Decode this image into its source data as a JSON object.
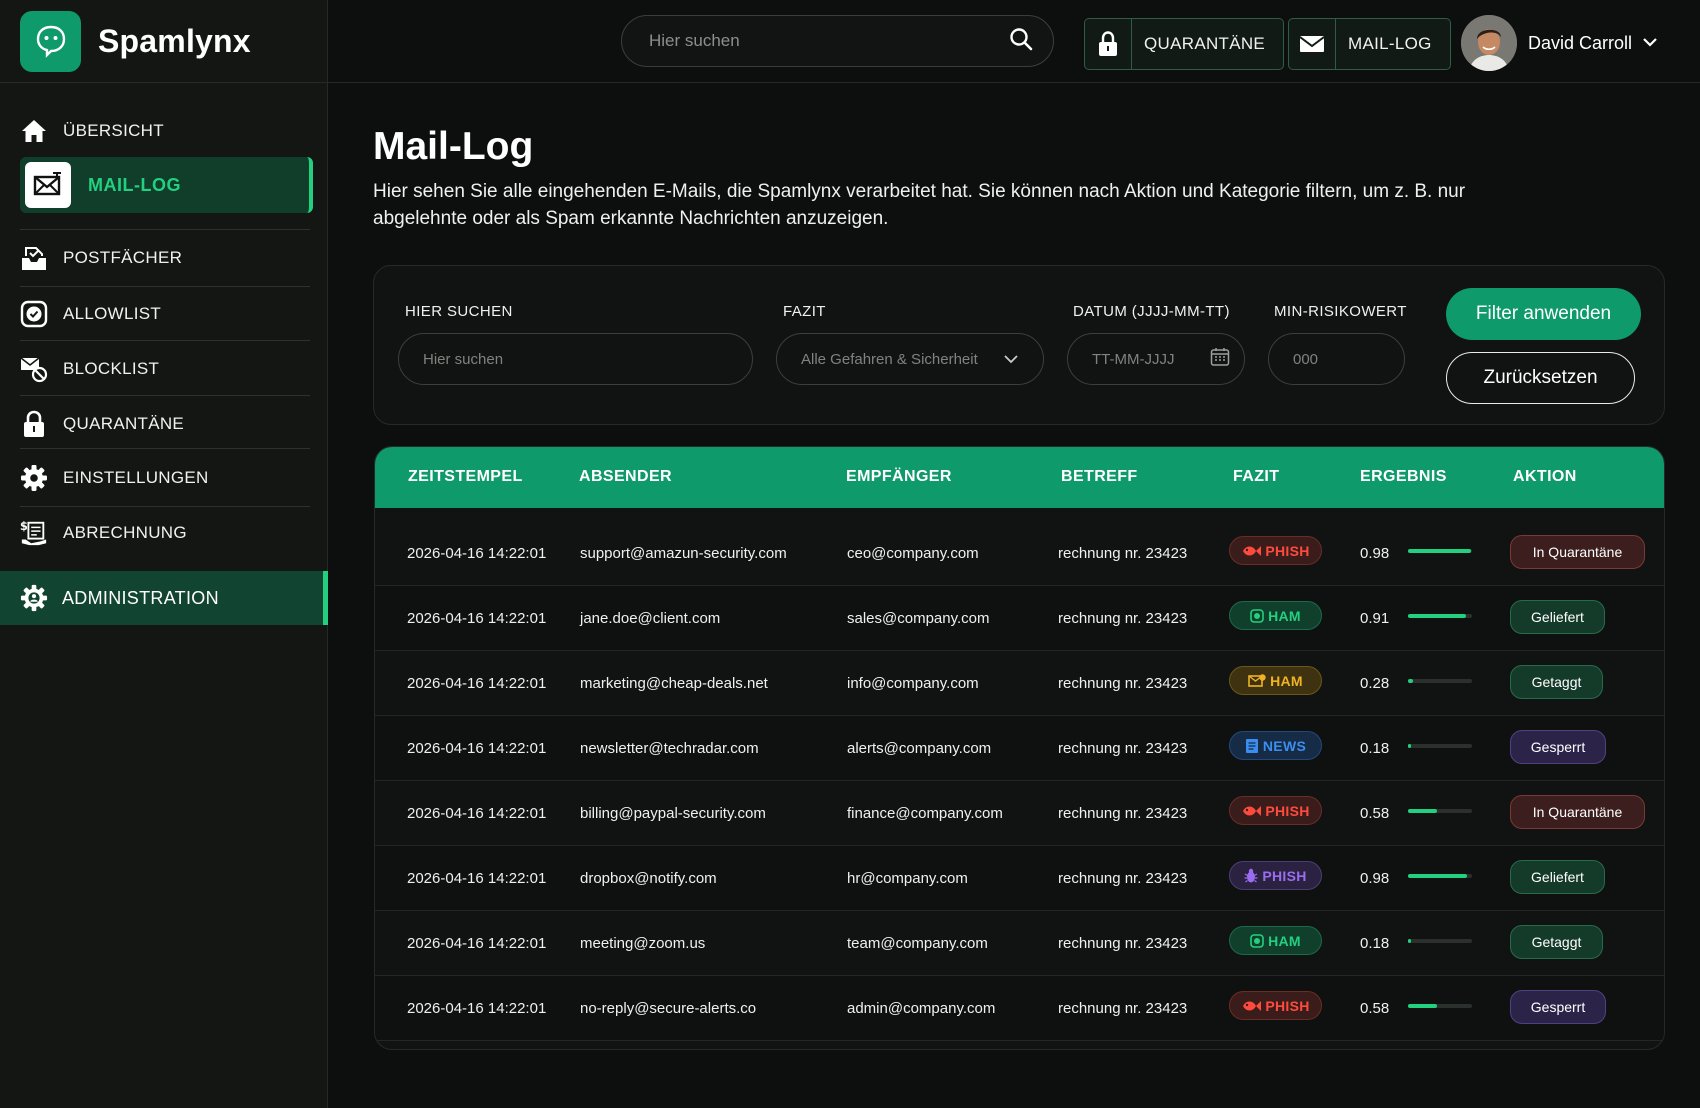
{
  "brand": {
    "name": "Spamlynx"
  },
  "sidebar": {
    "items": [
      {
        "label": "ÜBERSICHT",
        "icon": "home-icon"
      },
      {
        "label": "MAIL-LOG",
        "icon": "mail-log-icon",
        "active": true
      },
      {
        "label": "POSTFÄCHER",
        "icon": "inbox-icon"
      },
      {
        "label": "ALLOWLIST",
        "icon": "check-circle-icon"
      },
      {
        "label": "BLOCKLIST",
        "icon": "block-mail-icon"
      },
      {
        "label": "QUARANTÄNE",
        "icon": "lock-icon"
      },
      {
        "label": "EINSTELLUNGEN",
        "icon": "gear-icon"
      },
      {
        "label": "ABRECHNUNG",
        "icon": "billing-icon"
      }
    ],
    "admin": {
      "label": "ADMINISTRATION",
      "icon": "admin-gear-icon"
    }
  },
  "topbar": {
    "search_placeholder": "Hier suchen",
    "quarantine_label": "QUARANTÄNE",
    "maillog_label": "MAIL-LOG",
    "user_name": "David Carroll"
  },
  "page": {
    "title": "Mail-Log",
    "description": "Hier sehen Sie alle eingehenden E-Mails, die Spamlynx verarbeitet hat. Sie können nach Aktion und Kategorie filtern, um z. B. nur abgelehnte oder als Spam erkannte Nachrichten anzuzeigen."
  },
  "filters": {
    "search": {
      "label": "HIER SUCHEN",
      "placeholder": "Hier suchen"
    },
    "fazit": {
      "label": "FAZIT",
      "value": "Alle Gefahren & Sicherheit"
    },
    "date": {
      "label": "DATUM (JJJJ-MM-TT)",
      "placeholder": "TT-MM-JJJJ"
    },
    "risk": {
      "label": "MIN-RISIKOWERT",
      "placeholder": "000"
    },
    "apply_label": "Filter anwenden",
    "reset_label": "Zurücksetzen"
  },
  "table": {
    "columns": [
      "ZEITSTEMPEL",
      "ABSENDER",
      "EMPFÄNGER",
      "BETREFF",
      "FAZIT",
      "ERGEBNIS",
      "AKTION"
    ],
    "rows": [
      {
        "ts": "2026-04-16 14:22:01",
        "from": "support@amazun-security.com",
        "to": "ceo@company.com",
        "subject": "rechnung nr. 23423",
        "fazit": "PHISH",
        "fazit_kind": "phish-fish",
        "score": "0.98",
        "score_value": 0.98,
        "action": "In Quarantäne",
        "action_kind": "quarantine"
      },
      {
        "ts": "2026-04-16 14:22:01",
        "from": "jane.doe@client.com",
        "to": "sales@company.com",
        "subject": "rechnung nr. 23423",
        "fazit": "HAM",
        "fazit_kind": "ham-green",
        "score": "0.91",
        "score_value": 0.91,
        "action": "Geliefert",
        "action_kind": "delivered"
      },
      {
        "ts": "2026-04-16 14:22:01",
        "from": "marketing@cheap-deals.net",
        "to": "info@company.com",
        "subject": "rechnung nr. 23423",
        "fazit": "HAM",
        "fazit_kind": "ham-yellow",
        "score": "0.28",
        "score_value": 0.08,
        "action": "Getaggt",
        "action_kind": "tagged"
      },
      {
        "ts": "2026-04-16 14:22:01",
        "from": "newsletter@techradar.com",
        "to": "alerts@company.com",
        "subject": "rechnung nr. 23423",
        "fazit": "NEWS",
        "fazit_kind": "news",
        "score": "0.18",
        "score_value": 0.05,
        "action": "Gesperrt",
        "action_kind": "blocked"
      },
      {
        "ts": "2026-04-16 14:22:01",
        "from": "billing@paypal-security.com",
        "to": "finance@company.com",
        "subject": "rechnung nr. 23423",
        "fazit": "PHISH",
        "fazit_kind": "phish-fish",
        "score": "0.58",
        "score_value": 0.45,
        "action": "In Quarantäne",
        "action_kind": "quarantine"
      },
      {
        "ts": "2026-04-16 14:22:01",
        "from": "dropbox@notify.com",
        "to": "hr@company.com",
        "subject": "rechnung nr. 23423",
        "fazit": "PHISH",
        "fazit_kind": "phish-bug",
        "score": "0.98",
        "score_value": 0.92,
        "action": "Geliefert",
        "action_kind": "delivered"
      },
      {
        "ts": "2026-04-16 14:22:01",
        "from": "meeting@zoom.us",
        "to": "team@company.com",
        "subject": "rechnung nr. 23423",
        "fazit": "HAM",
        "fazit_kind": "ham-green",
        "score": "0.18",
        "score_value": 0.05,
        "action": "Getaggt",
        "action_kind": "tagged"
      },
      {
        "ts": "2026-04-16 14:22:01",
        "from": "no-reply@secure-alerts.co",
        "to": "admin@company.com",
        "subject": "rechnung nr. 23423",
        "fazit": "PHISH",
        "fazit_kind": "phish-fish",
        "score": "0.58",
        "score_value": 0.45,
        "action": "Gesperrt",
        "action_kind": "blocked"
      }
    ]
  },
  "colors": {
    "accent": "#0e9a6a",
    "accent_bright": "#22d07f",
    "phish": "#ff4b3e",
    "ham_green": "#22d07f",
    "ham_yellow": "#f0b323",
    "news": "#3b8df0",
    "phish_bug": "#9a6cf0"
  }
}
